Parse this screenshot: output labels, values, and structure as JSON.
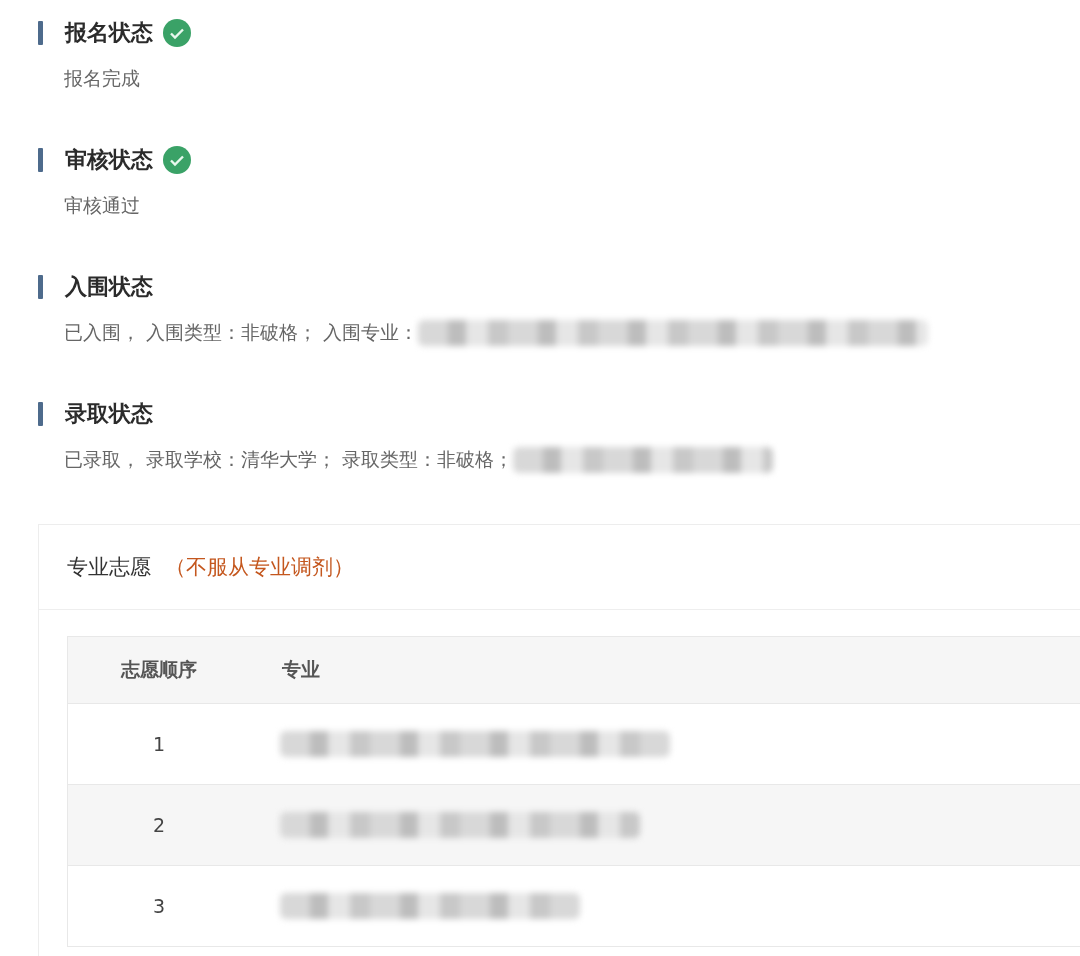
{
  "sections": [
    {
      "title": "报名状态",
      "verified": true,
      "text": "报名完成",
      "redacted": false
    },
    {
      "title": "审核状态",
      "verified": true,
      "text": "审核通过",
      "redacted": false
    },
    {
      "title": "入围状态",
      "verified": false,
      "text": "已入围， 入围类型：非破格； 入围专业：",
      "redacted": true
    },
    {
      "title": "录取状态",
      "verified": false,
      "text": "已录取， 录取学校：清华大学； 录取类型：非破格；",
      "redacted": true
    }
  ],
  "preferences": {
    "title": "专业志愿",
    "note": "（不服从专业调剂）",
    "table": {
      "columns": [
        "志愿顺序",
        "专业"
      ],
      "rows": [
        {
          "order": "1",
          "redacted": true
        },
        {
          "order": "2",
          "redacted": true
        },
        {
          "order": "3",
          "redacted": true
        }
      ]
    }
  }
}
